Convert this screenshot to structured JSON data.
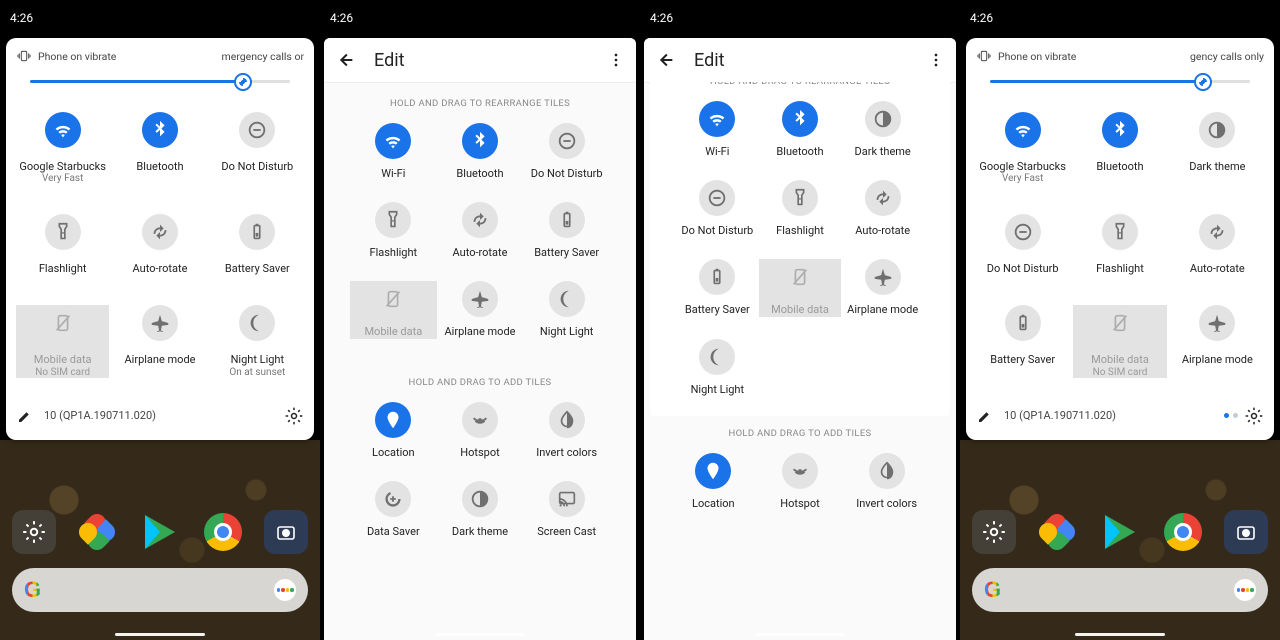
{
  "status_time": "4:26",
  "panel": {
    "vibrate_label": "Phone on vibrate",
    "emergency_partial_left": "mergency calls or",
    "emergency_partial_right": "gency calls only",
    "brightness_percent": 78,
    "build": "10 (QP1A.190711.020)"
  },
  "col1_tiles": [
    {
      "name": "wifi",
      "icon": "wifi",
      "state": "on",
      "label": "Google Starbucks",
      "sub": "Very Fast"
    },
    {
      "name": "bluetooth",
      "icon": "bluetooth",
      "state": "on",
      "label": "Bluetooth"
    },
    {
      "name": "dnd",
      "icon": "dnd",
      "state": "off",
      "label": "Do Not Disturb"
    },
    {
      "name": "flashlight",
      "icon": "flashlight",
      "state": "off",
      "label": "Flashlight"
    },
    {
      "name": "autorotate",
      "icon": "autorotate",
      "state": "off",
      "label": "Auto-rotate"
    },
    {
      "name": "battery",
      "icon": "battery",
      "state": "off",
      "label": "Battery Saver"
    },
    {
      "name": "mobiledata",
      "icon": "mobiledata",
      "state": "dim",
      "label": "Mobile data",
      "sub": "No SIM card"
    },
    {
      "name": "airplane",
      "icon": "airplane",
      "state": "off",
      "label": "Airplane mode"
    },
    {
      "name": "nightlight",
      "icon": "nightlight",
      "state": "off",
      "label": "Night Light",
      "sub": "On at sunset"
    }
  ],
  "col4_tiles": [
    {
      "name": "wifi",
      "icon": "wifi",
      "state": "on",
      "label": "Google Starbucks",
      "sub": "Very Fast"
    },
    {
      "name": "bluetooth",
      "icon": "bluetooth",
      "state": "on",
      "label": "Bluetooth"
    },
    {
      "name": "darktheme",
      "icon": "darktheme",
      "state": "off",
      "label": "Dark theme"
    },
    {
      "name": "dnd",
      "icon": "dnd",
      "state": "off",
      "label": "Do Not Disturb"
    },
    {
      "name": "flashlight",
      "icon": "flashlight",
      "state": "off",
      "label": "Flashlight"
    },
    {
      "name": "autorotate",
      "icon": "autorotate",
      "state": "off",
      "label": "Auto-rotate"
    },
    {
      "name": "battery",
      "icon": "battery",
      "state": "off",
      "label": "Battery Saver"
    },
    {
      "name": "mobiledata",
      "icon": "mobiledata",
      "state": "dim",
      "label": "Mobile data",
      "sub": "No SIM card"
    },
    {
      "name": "airplane",
      "icon": "airplane",
      "state": "off",
      "label": "Airplane mode"
    }
  ],
  "edit": {
    "title": "Edit",
    "hint_active": "HOLD AND DRAG TO REARRANGE TILES",
    "hint_pool": "HOLD AND DRAG TO ADD TILES"
  },
  "col2_active": [
    {
      "name": "wifi",
      "icon": "wifi",
      "state": "on",
      "label": "Wi-Fi"
    },
    {
      "name": "bluetooth",
      "icon": "bluetooth",
      "state": "on",
      "label": "Bluetooth"
    },
    {
      "name": "dnd",
      "icon": "dnd",
      "state": "off",
      "label": "Do Not Disturb"
    },
    {
      "name": "flashlight",
      "icon": "flashlight",
      "state": "off",
      "label": "Flashlight"
    },
    {
      "name": "autorotate",
      "icon": "autorotate",
      "state": "off",
      "label": "Auto-rotate"
    },
    {
      "name": "battery",
      "icon": "battery",
      "state": "off",
      "label": "Battery Saver"
    },
    {
      "name": "mobiledata",
      "icon": "mobiledata",
      "state": "dim",
      "label": "Mobile data"
    },
    {
      "name": "airplane",
      "icon": "airplane",
      "state": "off",
      "label": "Airplane mode"
    },
    {
      "name": "nightlight",
      "icon": "nightlight",
      "state": "off",
      "label": "Night Light"
    }
  ],
  "col2_pool": [
    {
      "name": "location",
      "icon": "location",
      "state": "on",
      "label": "Location"
    },
    {
      "name": "hotspot",
      "icon": "hotspot",
      "state": "off",
      "label": "Hotspot"
    },
    {
      "name": "invert",
      "icon": "invert",
      "state": "off",
      "label": "Invert colors"
    },
    {
      "name": "datasaver",
      "icon": "datasaver",
      "state": "off",
      "label": "Data Saver"
    },
    {
      "name": "darktheme",
      "icon": "darktheme",
      "state": "off",
      "label": "Dark theme"
    },
    {
      "name": "cast",
      "icon": "cast",
      "state": "off",
      "label": "Screen Cast"
    }
  ],
  "col3_active": [
    {
      "name": "wifi",
      "icon": "wifi",
      "state": "on",
      "label": "Wi-Fi"
    },
    {
      "name": "bluetooth",
      "icon": "bluetooth",
      "state": "on",
      "label": "Bluetooth"
    },
    {
      "name": "darktheme",
      "icon": "darktheme",
      "state": "off",
      "label": "Dark theme"
    },
    {
      "name": "dnd",
      "icon": "dnd",
      "state": "off",
      "label": "Do Not Disturb"
    },
    {
      "name": "flashlight",
      "icon": "flashlight",
      "state": "off",
      "label": "Flashlight"
    },
    {
      "name": "autorotate",
      "icon": "autorotate",
      "state": "off",
      "label": "Auto-rotate"
    },
    {
      "name": "battery",
      "icon": "battery",
      "state": "off",
      "label": "Battery Saver"
    },
    {
      "name": "mobiledata",
      "icon": "mobiledata",
      "state": "dim",
      "label": "Mobile data"
    },
    {
      "name": "airplane",
      "icon": "airplane",
      "state": "off",
      "label": "Airplane mode"
    },
    {
      "name": "nightlight",
      "icon": "nightlight",
      "state": "off",
      "label": "Night Light"
    }
  ],
  "col3_pool": [
    {
      "name": "location",
      "icon": "location",
      "state": "on",
      "label": "Location"
    },
    {
      "name": "hotspot",
      "icon": "hotspot",
      "state": "off",
      "label": "Hotspot"
    },
    {
      "name": "invert",
      "icon": "invert",
      "state": "off",
      "label": "Invert colors"
    }
  ]
}
